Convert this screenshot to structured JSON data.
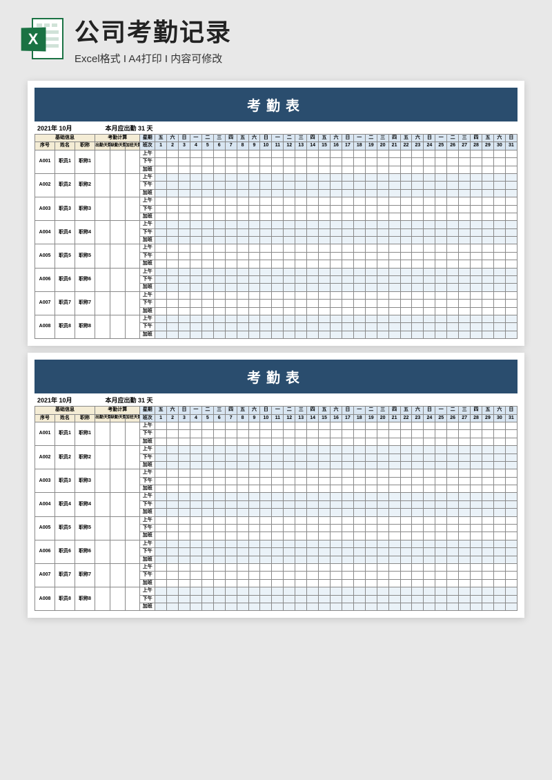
{
  "header": {
    "title": "公司考勤记录",
    "subtitle": "Excel格式 I A4打印 I 内容可修改",
    "icon_letter": "X"
  },
  "sheet": {
    "title": "考勤表",
    "date_label": "2021年 10月",
    "month_days_label": "本月应出勤 31 天",
    "groups": {
      "basic_info": "基础信息",
      "attendance_calc": "考勤计算",
      "weekday": "星期",
      "shift": "班次"
    },
    "info_headers": [
      "序号",
      "姓名",
      "职称"
    ],
    "calc_headers": [
      "出勤天数",
      "缺勤天数",
      "加班天数"
    ],
    "weekdays": [
      "五",
      "六",
      "日",
      "一",
      "二",
      "三",
      "四",
      "五",
      "六",
      "日",
      "一",
      "二",
      "三",
      "四",
      "五",
      "六",
      "日",
      "一",
      "二",
      "三",
      "四",
      "五",
      "六",
      "日",
      "一",
      "二",
      "三",
      "四",
      "五",
      "六",
      "日"
    ],
    "day_numbers": [
      1,
      2,
      3,
      4,
      5,
      6,
      7,
      8,
      9,
      10,
      11,
      12,
      13,
      14,
      15,
      16,
      17,
      18,
      19,
      20,
      21,
      22,
      23,
      24,
      25,
      26,
      27,
      28,
      29,
      30,
      31
    ],
    "periods": [
      "上午",
      "下午",
      "加班"
    ],
    "employees": [
      {
        "id": "A001",
        "name": "职员1",
        "title": "职称1"
      },
      {
        "id": "A002",
        "name": "职员2",
        "title": "职称2"
      },
      {
        "id": "A003",
        "name": "职员3",
        "title": "职称3"
      },
      {
        "id": "A004",
        "name": "职员4",
        "title": "职称4"
      },
      {
        "id": "A005",
        "name": "职员5",
        "title": "职称5"
      },
      {
        "id": "A006",
        "name": "职员6",
        "title": "职称6"
      },
      {
        "id": "A007",
        "name": "职员7",
        "title": "职称7"
      },
      {
        "id": "A008",
        "name": "职员8",
        "title": "职称8"
      }
    ]
  }
}
